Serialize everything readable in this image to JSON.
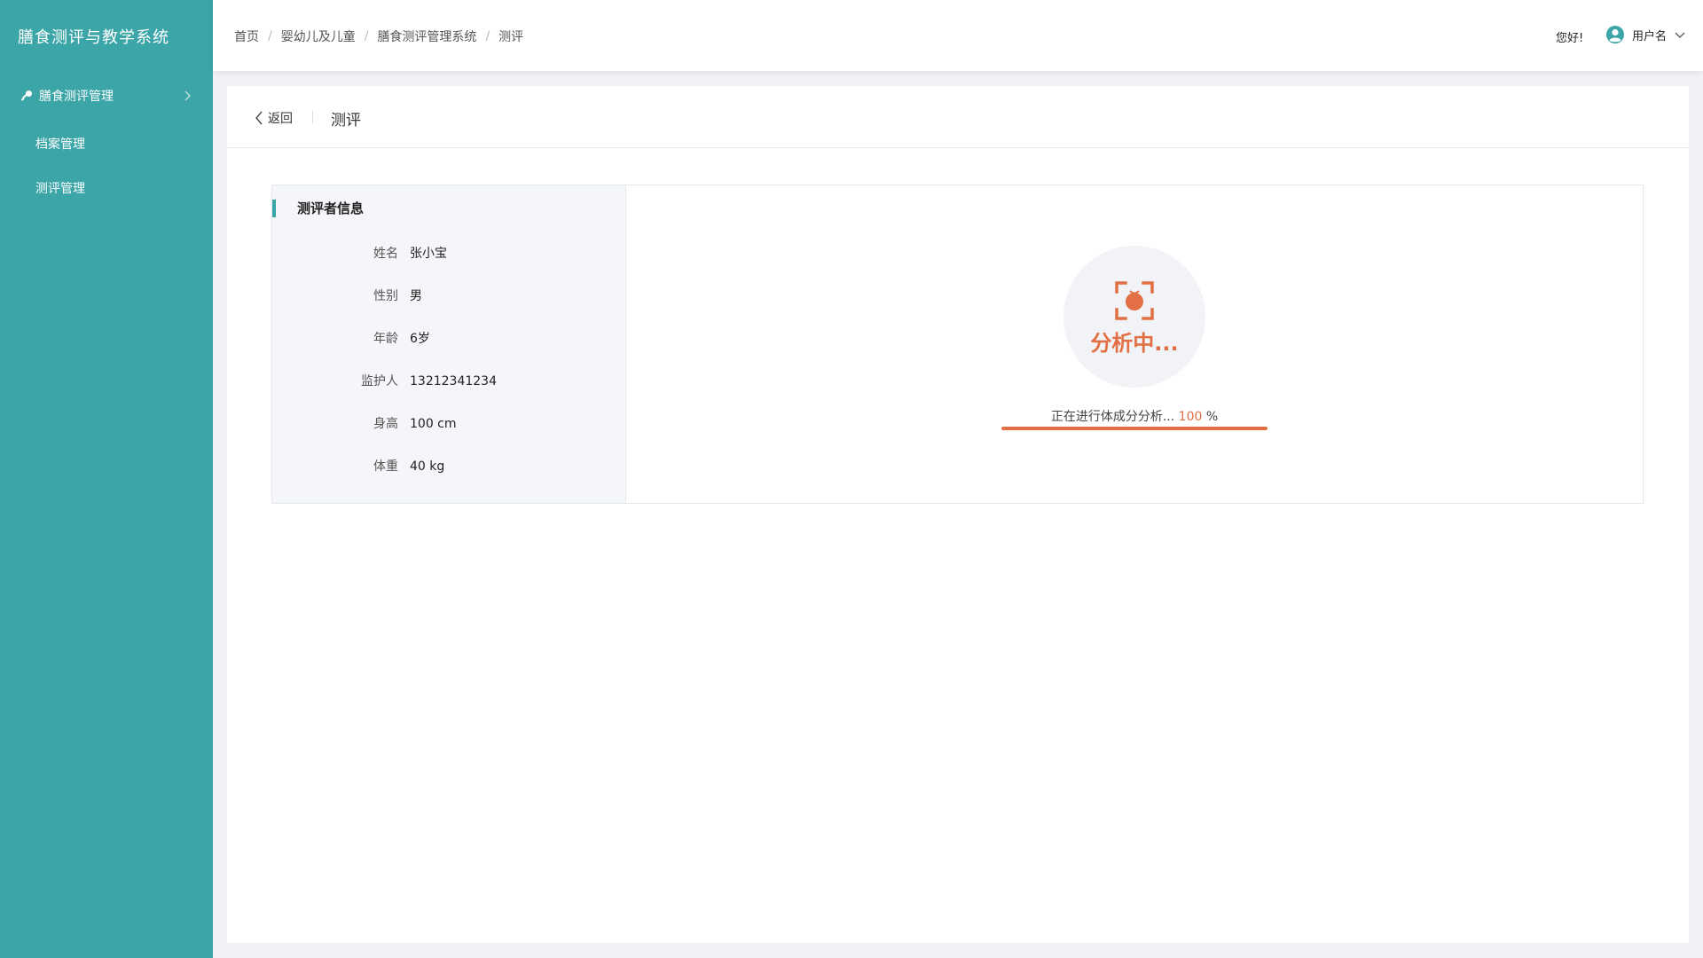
{
  "app": {
    "title": "膳食测评与教学系统"
  },
  "sidebar": {
    "group_label": "膳食测评管理",
    "group_icon": "key-icon",
    "items": [
      {
        "label": "档案管理"
      },
      {
        "label": "测评管理"
      }
    ]
  },
  "header": {
    "breadcrumb": [
      "首页",
      "婴幼儿及儿童",
      "膳食测评管理系统",
      "测评"
    ],
    "greeting": "您好!",
    "username": "用户名"
  },
  "page": {
    "back_label": "返回",
    "title": "测评"
  },
  "info": {
    "title": "测评者信息",
    "rows": [
      {
        "label": "姓名",
        "value": "张小宝"
      },
      {
        "label": "性别",
        "value": "男"
      },
      {
        "label": "年龄",
        "value": "6岁"
      },
      {
        "label": "监护人",
        "value": "13212341234"
      },
      {
        "label": "身高",
        "value": "100 cm"
      },
      {
        "label": "体重",
        "value": "40 kg"
      }
    ]
  },
  "analysis": {
    "status_text": "分析中...",
    "progress_prefix": "正在进行体成分分析... ",
    "progress_value": "100",
    "progress_suffix": " %",
    "progress_fraction": 1.0
  },
  "colors": {
    "sidebar_bg": "#3ba5a8",
    "accent": "#e27044"
  }
}
